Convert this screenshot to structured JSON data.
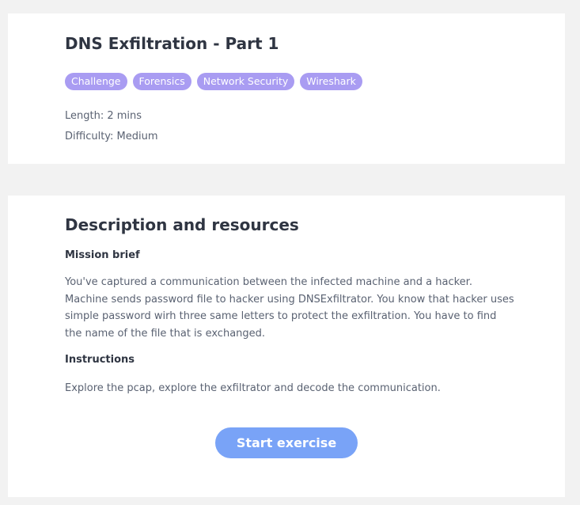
{
  "exercise": {
    "title": "DNS Exfiltration - Part 1",
    "tags": [
      "Challenge",
      "Forensics",
      "Network Security",
      "Wireshark"
    ],
    "length": "Length: 2 mins",
    "difficulty": "Difficulty: Medium"
  },
  "description": {
    "heading": "Description and resources",
    "mission_heading": "Mission brief",
    "mission_text": "You've captured a communication between the infected machine and a hacker. Machine sends password file to hacker using DNSExfiltrator. You know that hacker uses simple password wirh three same letters to protect the exfiltration. You have to find the name of the file that is exchanged.",
    "instructions_heading": "Instructions",
    "instructions_text": "Explore the pcap, explore the exfiltrator and decode the communication."
  },
  "actions": {
    "start_label": "Start exercise"
  },
  "colors": {
    "tag_background": "#a99cf2",
    "button_background": "#79a3f7",
    "page_background": "#f2f2f2",
    "heading_text": "#2f3542"
  }
}
